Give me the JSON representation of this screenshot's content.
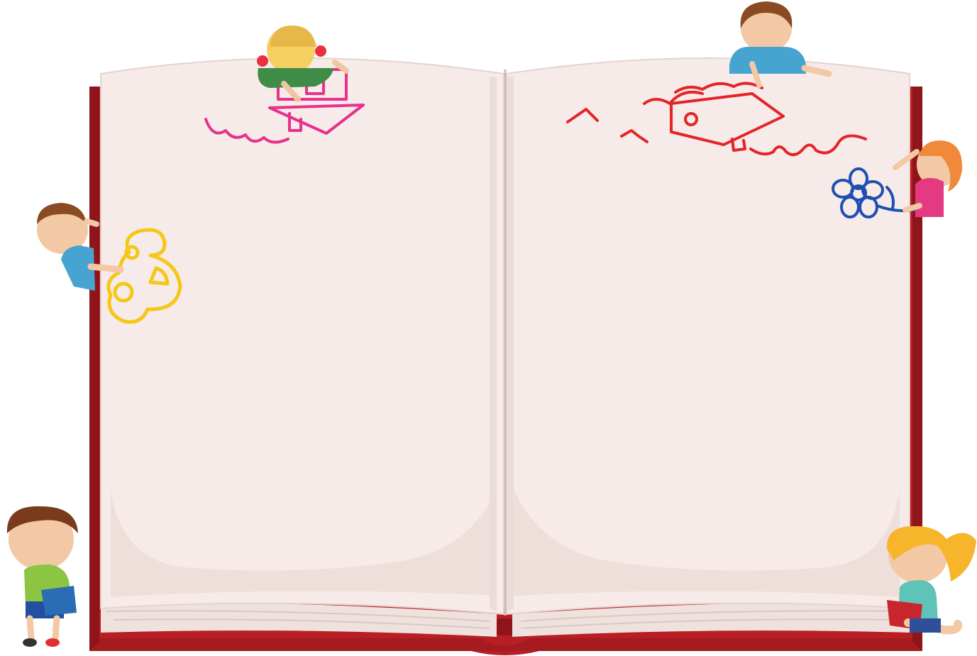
{
  "illustration": {
    "colors": {
      "background": "#ffffff",
      "cover": "#b81f25",
      "cover_dark": "#8e1519",
      "page": "#f6ebe8",
      "page_shadow": "#e8d6d2",
      "page_edge": "#d9c7c2",
      "pink_doodle": "#e6318d",
      "red_doodle": "#e42428",
      "yellow_doodle": "#f5c718",
      "blue_doodle": "#1f4fb3"
    },
    "icons": [
      "open-book-icon",
      "house-doodle-icon",
      "flower-doodle-icon",
      "child-figure-icon"
    ]
  }
}
